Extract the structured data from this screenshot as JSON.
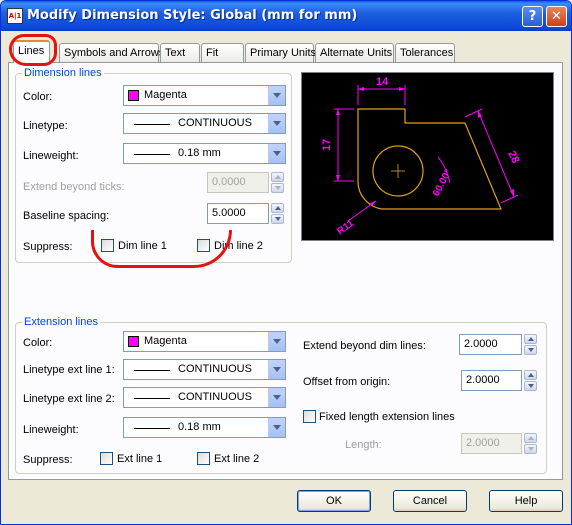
{
  "window": {
    "title": "Modify Dimension Style: Global (mm for mm)",
    "icon_text": "A|1",
    "help_glyph": "?",
    "close_glyph": "✕"
  },
  "tabs": [
    "Lines",
    "Symbols and Arrows",
    "Text",
    "Fit",
    "Primary Units",
    "Alternate Units",
    "Tolerances"
  ],
  "dimension_lines": {
    "group_label": "Dimension lines",
    "color_label": "Color:",
    "color_value": "Magenta",
    "color_hex": "#ff00ff",
    "linetype_label": "Linetype:",
    "linetype_value": "CONTINUOUS",
    "lineweight_label": "Lineweight:",
    "lineweight_value": "0.18 mm",
    "extend_label": "Extend beyond ticks:",
    "extend_value": "0.0000",
    "baseline_label": "Baseline spacing:",
    "baseline_value": "5.0000",
    "suppress_label": "Suppress:",
    "dim_line1_label": "Dim line 1",
    "dim_line2_label": "Dim line 2"
  },
  "preview": {
    "dim_top": "14",
    "dim_left": "17",
    "dim_right": "28",
    "dim_angle": "60.00°",
    "dim_radius": "R11"
  },
  "extension_lines": {
    "group_label": "Extension lines",
    "color_label": "Color:",
    "color_value": "Magenta",
    "linetype1_label": "Linetype ext line 1:",
    "linetype1_value": "CONTINUOUS",
    "linetype2_label": "Linetype ext line 2:",
    "linetype2_value": "CONTINUOUS",
    "lineweight_label": "Lineweight:",
    "lineweight_value": "0.18 mm",
    "suppress_label": "Suppress:",
    "ext_line1_label": "Ext line 1",
    "ext_line2_label": "Ext line 2",
    "extend_beyond_label": "Extend beyond dim lines:",
    "extend_beyond_value": "2.0000",
    "offset_label": "Offset from origin:",
    "offset_value": "2.0000",
    "fixed_length_label": "Fixed length extension lines",
    "length_label": "Length:",
    "length_value": "2.0000"
  },
  "buttons": {
    "ok": "OK",
    "cancel": "Cancel",
    "help": "Help"
  }
}
